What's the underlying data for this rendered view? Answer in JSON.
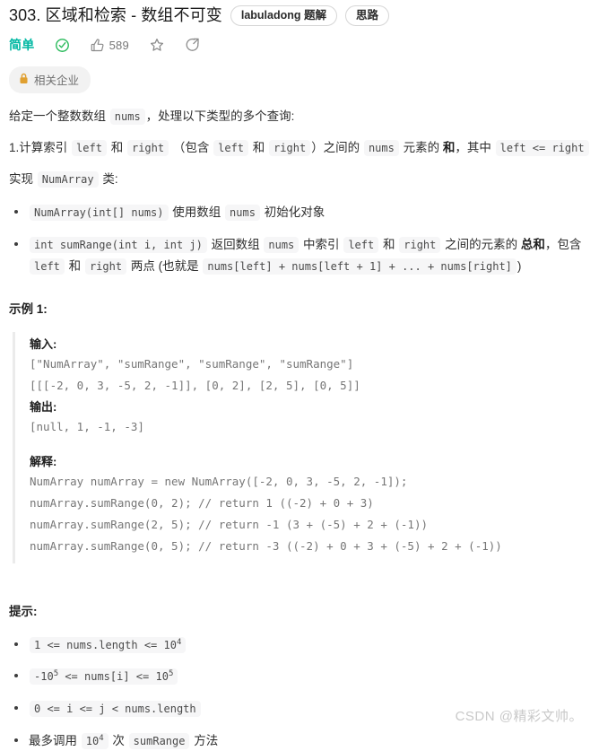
{
  "header": {
    "title": "303. 区域和检索 - 数组不可变",
    "tags": [
      {
        "label": "labuladong 题解",
        "name": "tag-labuladong"
      },
      {
        "label": "思路",
        "name": "tag-thinking"
      }
    ]
  },
  "meta": {
    "difficulty": "简单",
    "difficulty_color": "#00b8a3",
    "solved_icon": "check-circle-icon",
    "like_icon": "thumbs-up-icon",
    "like_count": "589",
    "favorite_icon": "star-icon",
    "share_icon": "share-icon"
  },
  "company_badge": {
    "icon": "lock-icon",
    "icon_color": "#e0a030",
    "label": "相关企业"
  },
  "description": {
    "intro_prefix": "给定一个整数数组",
    "intro_code": "nums",
    "intro_suffix": "，处理以下类型的多个查询:",
    "query_number": "1.",
    "query_parts": [
      "计算索引",
      "left",
      "和",
      "right",
      "（包含",
      "left",
      "和",
      "right",
      "）之间的",
      "nums",
      "元素的",
      "和",
      "，其中",
      "left <= right"
    ],
    "impl_prefix": "实现",
    "impl_code": "NumArray",
    "impl_suffix": "类:"
  },
  "methods": [
    {
      "signature": "NumArray(int[] nums)",
      "text_1": "使用数组",
      "code_1": "nums",
      "text_2": "初始化对象"
    },
    {
      "signature": "int sumRange(int i, int j)",
      "text_1": "返回数组",
      "code_1": "nums",
      "text_2": "中索引",
      "code_2": "left",
      "text_3": "和",
      "code_3": "right",
      "text_4": "之间的元素的",
      "bold_1": "总和",
      "text_5": "，包含",
      "code_4": "left",
      "text_6": "和",
      "code_5": "right",
      "text_7": "两点 (也就是",
      "code_6": "nums[left] + nums[left + 1] + ... + nums[right]",
      "text_8": ")"
    }
  ],
  "example": {
    "heading": "示例 1:",
    "input_label": "输入:",
    "input_lines": [
      "[\"NumArray\", \"sumRange\", \"sumRange\", \"sumRange\"]",
      "[[[-2, 0, 3, -5, 2, -1]], [0, 2], [2, 5], [0, 5]]"
    ],
    "output_label": "输出:",
    "output_lines": [
      "[null, 1, -1, -3]"
    ],
    "explain_label": "解释:",
    "explain_lines": [
      "NumArray numArray = new NumArray([-2, 0, 3, -5, 2, -1]);",
      "numArray.sumRange(0, 2); // return 1 ((-2) + 0 + 3)",
      "numArray.sumRange(2, 5); // return -1 (3 + (-5) + 2 + (-1))",
      "numArray.sumRange(0, 5); // return -3 ((-2) + 0 + 3 + (-5) + 2 + (-1))"
    ]
  },
  "hints": {
    "heading": "提示:",
    "items": [
      {
        "kind": "code",
        "pre": "1 <= nums.length <= 10",
        "sup": "4",
        "post": ""
      },
      {
        "kind": "code",
        "pre": "-10",
        "sup": "5",
        "post": " <= nums[i] <= 10",
        "sup2": "5"
      },
      {
        "kind": "code",
        "pre": "0 <= i <= j < nums.length",
        "sup": "",
        "post": ""
      },
      {
        "kind": "mixed",
        "text_1": "最多调用",
        "code_1": "10",
        "code_1_sup": "4",
        "text_2": "次",
        "code_2": "sumRange",
        "text_3": "方法"
      }
    ]
  },
  "watermark": "CSDN @精彩文帅。"
}
